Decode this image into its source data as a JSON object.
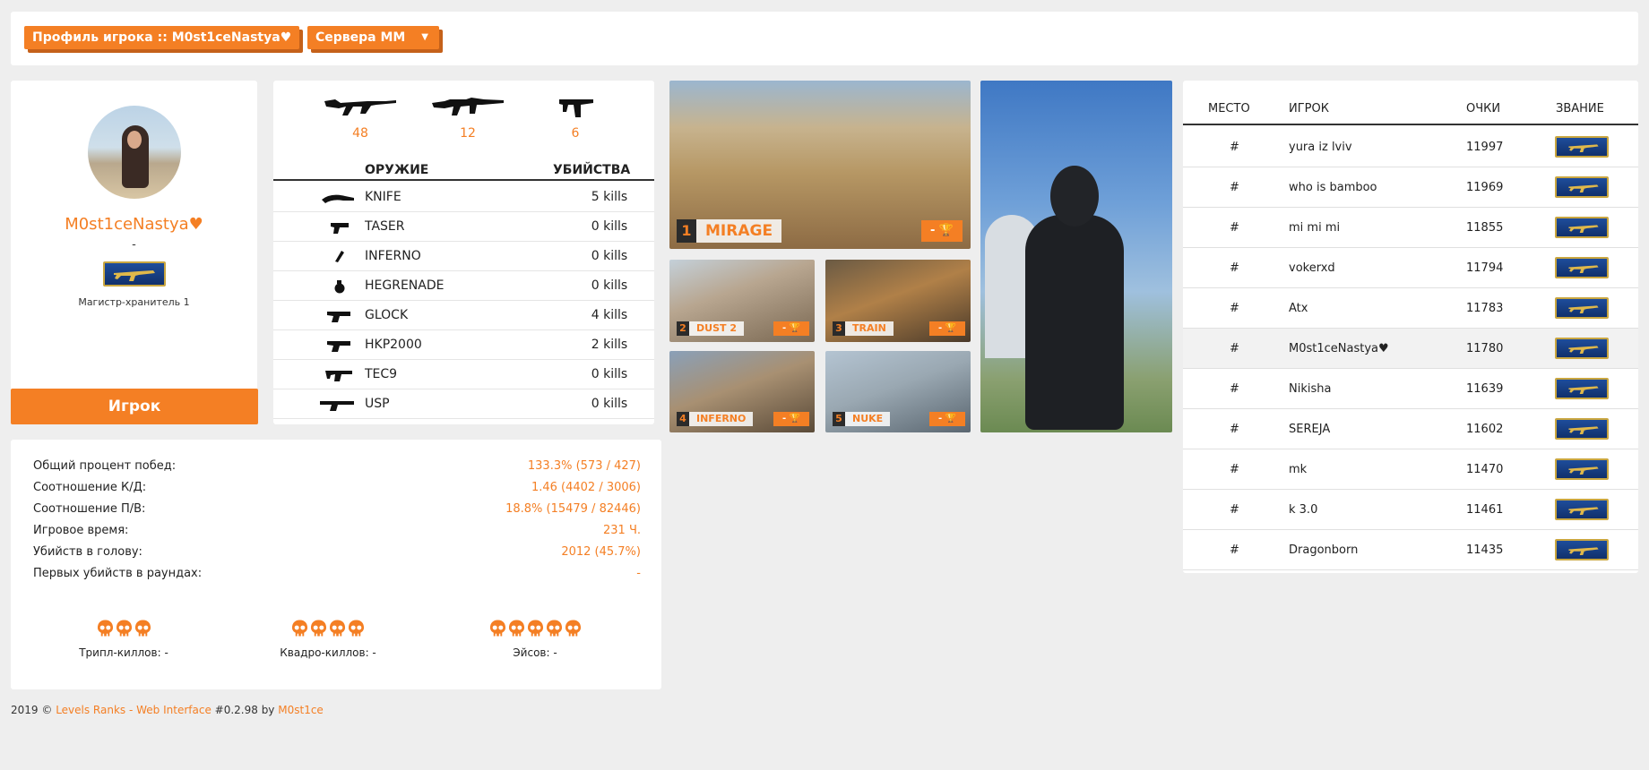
{
  "header": {
    "profile_button": "Профиль игрока :: M0st1ceNastya♥",
    "servers_button": "Сервера ММ",
    "servers_caret": "▼"
  },
  "profile": {
    "name": "M0st1ceNastya♥",
    "subtitle": "-",
    "rank_name": "Магистр-хранитель 1",
    "role_button": "Игрок"
  },
  "weapons": {
    "top": [
      {
        "icon": "ak47-icon",
        "count": "48"
      },
      {
        "icon": "m4a1-icon",
        "count": "12"
      },
      {
        "icon": "mac10-icon",
        "count": "6"
      }
    ],
    "col_weapon": "ОРУЖИЕ",
    "col_kills": "УБИЙСТВА",
    "rows": [
      {
        "icon": "knife-icon",
        "name": "KNIFE",
        "kills": "5 kills"
      },
      {
        "icon": "taser-icon",
        "name": "TASER",
        "kills": "0 kills"
      },
      {
        "icon": "inferno-icon",
        "name": "INFERNO",
        "kills": "0 kills"
      },
      {
        "icon": "hegrenade-icon",
        "name": "HEGRENADE",
        "kills": "0 kills"
      },
      {
        "icon": "glock-icon",
        "name": "GLOCK",
        "kills": "4 kills"
      },
      {
        "icon": "hkp2000-icon",
        "name": "HKP2000",
        "kills": "2 kills"
      },
      {
        "icon": "tec9-icon",
        "name": "TEC9",
        "kills": "0 kills"
      },
      {
        "icon": "usp-icon",
        "name": "USP",
        "kills": "0 kills"
      }
    ]
  },
  "maps": [
    {
      "num": "1",
      "name": "MIRAGE",
      "result": "-",
      "cup": "🏆"
    },
    {
      "num": "2",
      "name": "DUST 2",
      "result": "-",
      "cup": "🏆"
    },
    {
      "num": "3",
      "name": "TRAIN",
      "result": "-",
      "cup": "🏆"
    },
    {
      "num": "4",
      "name": "INFERNO",
      "result": "-",
      "cup": "🏆"
    },
    {
      "num": "5",
      "name": "NUKE",
      "result": "-",
      "cup": "🏆"
    }
  ],
  "leaderboard": {
    "col_place": "МЕСТО",
    "col_player": "ИГРОК",
    "col_points": "ОЧКИ",
    "col_rank": "ЗВАНИЕ",
    "rows": [
      {
        "place": "#",
        "player": "yura iz lviv",
        "points": "11997"
      },
      {
        "place": "#",
        "player": "who is bamboo",
        "points": "11969"
      },
      {
        "place": "#",
        "player": "mi mi mi",
        "points": "11855"
      },
      {
        "place": "#",
        "player": "vokerxd",
        "points": "11794"
      },
      {
        "place": "#",
        "player": "Atx",
        "points": "11783"
      },
      {
        "place": "#",
        "player": "M0st1ceNastya♥",
        "points": "11780"
      },
      {
        "place": "#",
        "player": "Nikisha",
        "points": "11639"
      },
      {
        "place": "#",
        "player": "SEREJA",
        "points": "11602"
      },
      {
        "place": "#",
        "player": "mk",
        "points": "11470"
      },
      {
        "place": "#",
        "player": "k 3.0",
        "points": "11461"
      },
      {
        "place": "#",
        "player": "Dragonborn",
        "points": "11435"
      }
    ]
  },
  "stats": {
    "rows": [
      {
        "label": "Общий процент побед:",
        "value": "133.3% (573 / 427)"
      },
      {
        "label": "Соотношение К/Д:",
        "value": "1.46 (4402 / 3006)"
      },
      {
        "label": "Соотношение П/В:",
        "value": "18.8% (15479 / 82446)"
      },
      {
        "label": "Игровое время:",
        "value": "231 Ч."
      },
      {
        "label": "Убийств в голову:",
        "value": "2012 (45.7%)"
      },
      {
        "label": "Первых убийств в раундах:",
        "value": "-"
      }
    ],
    "triple": "Трипл-киллов: -",
    "quadro": "Квадро-киллов: -",
    "ace": "Эйсов: -"
  },
  "footer": {
    "prefix": "2019 ©",
    "link1": "Levels Ranks - Web Interface",
    "version": "#0.2.98 by",
    "link2": "M0st1ce"
  },
  "colors": {
    "accent": "#f47f24",
    "background": "#eeeeee",
    "panel": "#ffffff"
  }
}
